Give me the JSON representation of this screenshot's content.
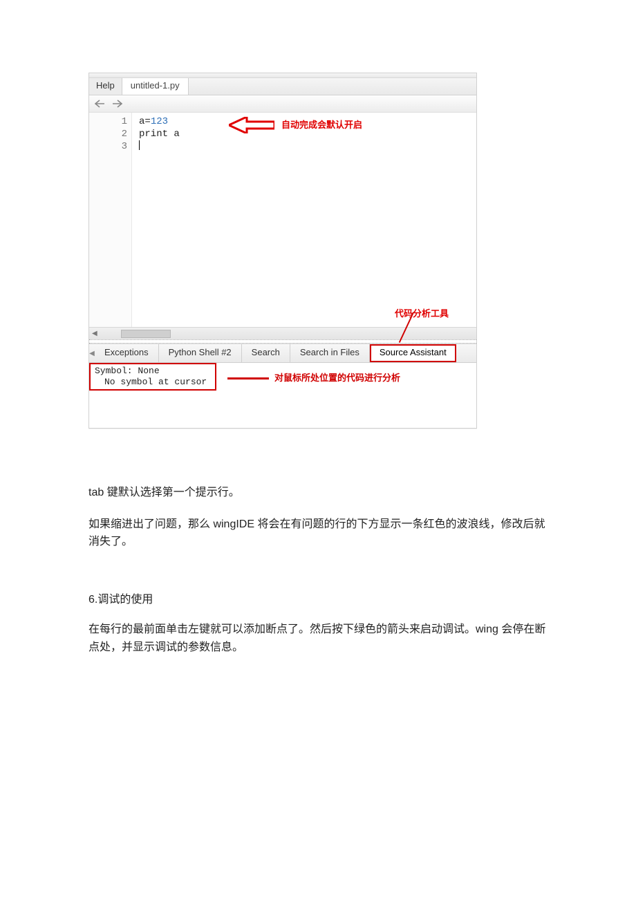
{
  "ide": {
    "menu": {
      "help": "Help"
    },
    "file_tab": "untitled-1.py",
    "gutter_lines": [
      "1",
      "2",
      "3"
    ],
    "code_line1_prefix": "a=",
    "code_line1_num": "123",
    "code_line2": "print a",
    "anno_autocomplete": "自动完成会默认开启",
    "anno_code_analysis": "代码分析工具",
    "tabs": {
      "exceptions": "Exceptions",
      "python_shell": "Python Shell #2",
      "search": "Search",
      "search_in_files": "Search in Files",
      "source_assistant": "Source Assistant"
    },
    "symbol_line1": "Symbol: None",
    "symbol_line2": "No symbol at cursor",
    "anno_cursor_analysis": "对鼠标所处位置的代码进行分析"
  },
  "doc": {
    "p1": "tab 键默认选择第一个提示行。",
    "p2": "如果缩进出了问题，那么 wingIDE 将会在有问题的行的下方显示一条红色的波浪线，修改后就消失了。",
    "section6_title": "6.调试的使用",
    "p3": "在每行的最前面单击左键就可以添加断点了。然后按下绿色的箭头来启动调试。wing 会停在断点处，并显示调试的参数信息。"
  }
}
